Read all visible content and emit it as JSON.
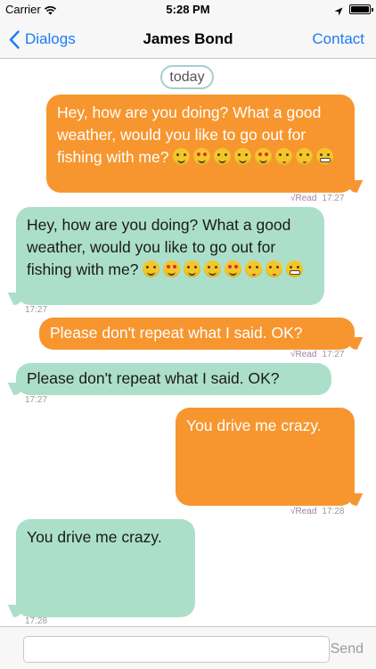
{
  "status_bar": {
    "carrier": "Carrier",
    "time": "5:28 PM"
  },
  "nav": {
    "back_label": "Dialogs",
    "title": "James Bond",
    "contact_label": "Contact"
  },
  "chat": {
    "day_label": "today",
    "messages": [
      {
        "direction": "outgoing",
        "text": "Hey, how are you doing? What a good weather, would you like to go out for fishing with me? ",
        "emojis": [
          "smiling-face-icon",
          "heart-eyes-icon",
          "smiley-icon",
          "grinning-face-icon",
          "heart-eyes-icon",
          "kissing-heart-icon",
          "kissing-closed-eyes-icon",
          "grimacing-face-icon"
        ],
        "read": "√Read",
        "time": "17:27"
      },
      {
        "direction": "incoming",
        "text": "Hey, how are you doing? What a good weather, would you like to go out for fishing with me? ",
        "emojis": [
          "smiling-face-icon",
          "heart-eyes-icon",
          "smiley-icon",
          "grinning-face-icon",
          "heart-eyes-icon",
          "kissing-heart-icon",
          "kissing-closed-eyes-icon",
          "grimacing-face-icon"
        ],
        "time": "17:27"
      },
      {
        "direction": "outgoing",
        "text": "Please don't repeat what I said. OK?",
        "read": "√Read",
        "time": "17:27"
      },
      {
        "direction": "incoming",
        "text": "Please don't repeat what I said. OK?",
        "time": "17:27"
      },
      {
        "direction": "outgoing",
        "text": "You drive me crazy.",
        "read": "√Read",
        "time": "17:28"
      },
      {
        "direction": "incoming",
        "text": "You drive me crazy.",
        "time": "17:28"
      }
    ]
  },
  "composer": {
    "value": "",
    "placeholder": "",
    "send_label": "Send"
  },
  "colors": {
    "accent": "#1a7cf4",
    "outgoing_bubble": "#f7962f",
    "incoming_bubble": "#acdfca"
  }
}
